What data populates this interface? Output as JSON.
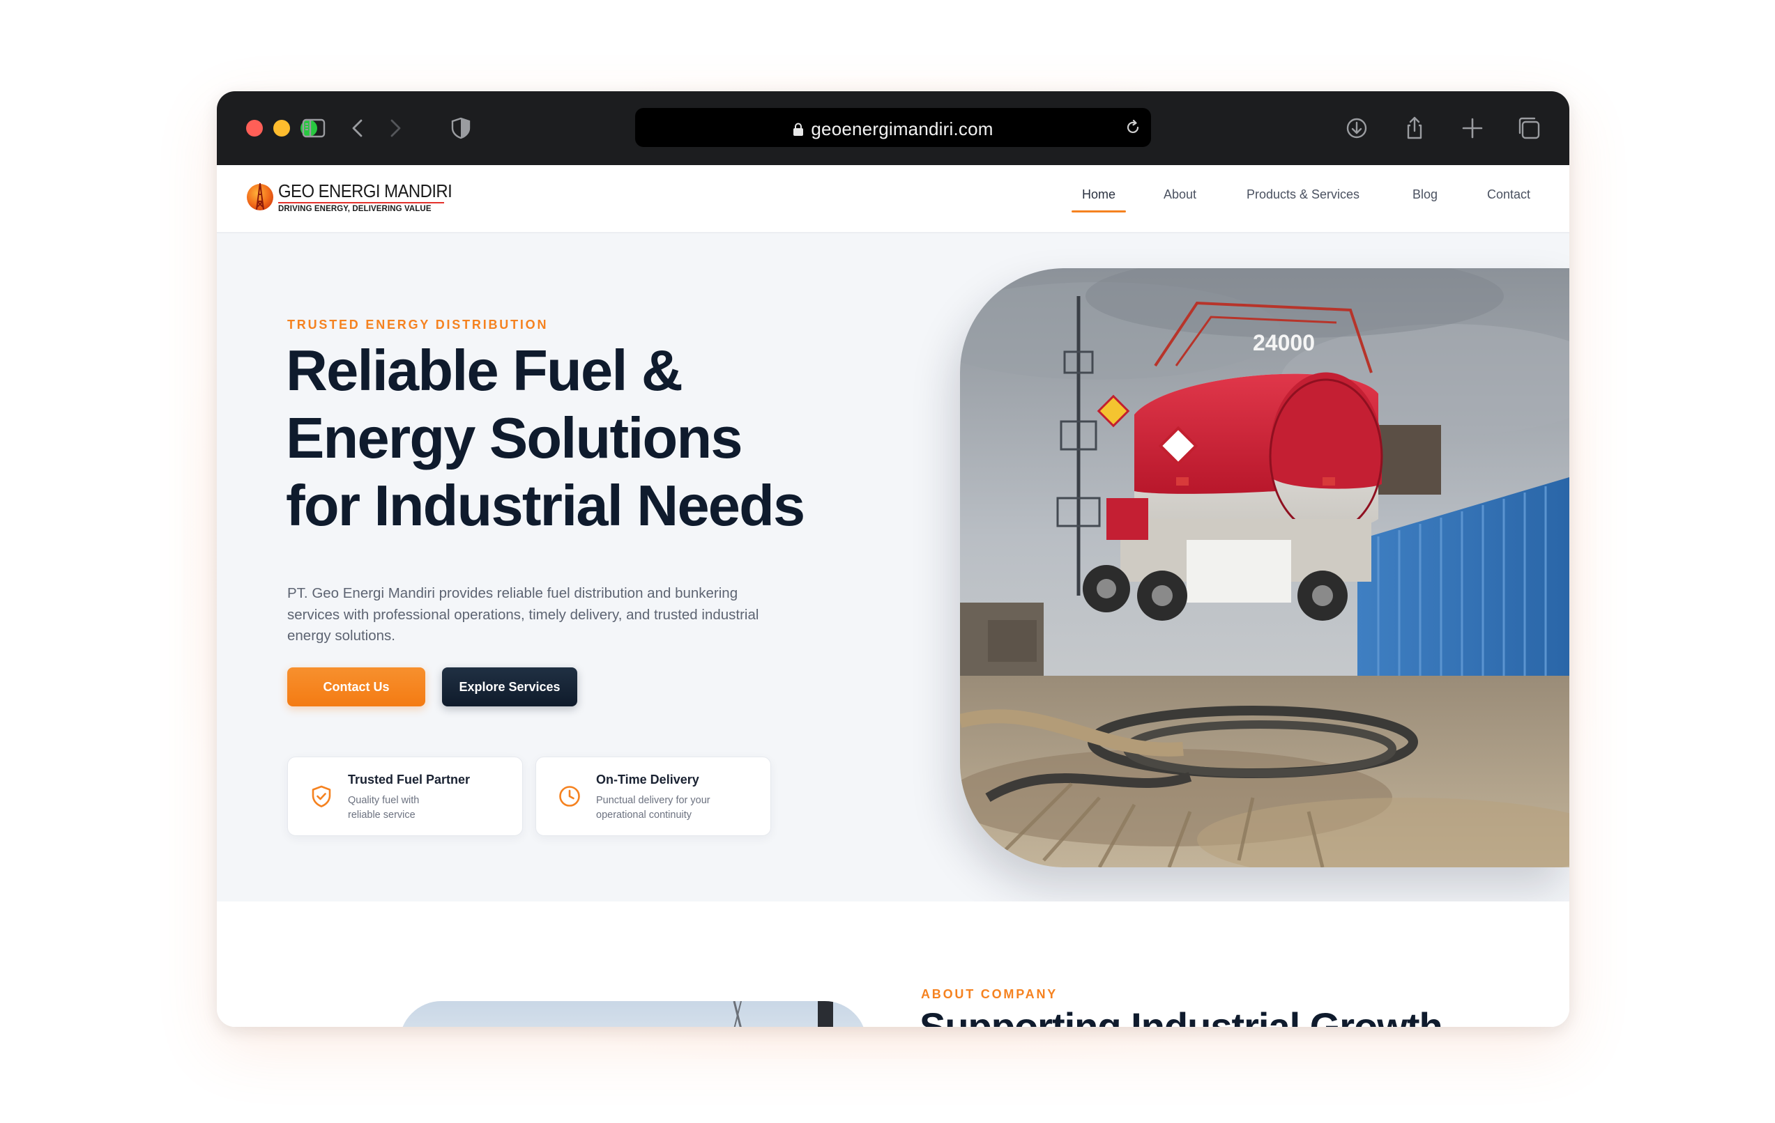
{
  "browser": {
    "url": "geoenergimandiri.com",
    "icons": [
      "sidebar-icon",
      "back-icon",
      "forward-icon",
      "shield-icon",
      "lock-icon",
      "reload-icon",
      "download-icon",
      "share-icon",
      "new-tab-icon",
      "tabs-overview-icon"
    ]
  },
  "header": {
    "logo": {
      "name": "GEO ENERGI MANDIRI",
      "tagline": "DRIVING ENERGY, DELIVERING VALUE"
    },
    "nav": {
      "home": "Home",
      "about": "About",
      "products": "Products & Services",
      "blog": "Blog",
      "contact": "Contact"
    },
    "active": "Home"
  },
  "hero": {
    "eyebrow": "TRUSTED ENERGY DISTRIBUTION",
    "title_line1": "Reliable Fuel &",
    "title_line2": "Energy Solutions",
    "title_line3": "for Industrial Needs",
    "description": "PT. Geo Energi Mandiri provides reliable fuel distribution and bunkering services with professional operations, timely delivery, and trusted industrial energy solutions.",
    "primary_button": "Contact Us",
    "secondary_button": "Explore Services",
    "features": [
      {
        "icon": "shield-check-icon",
        "title": "Trusted Fuel Partner",
        "description": "Quality fuel with reliable service"
      },
      {
        "icon": "clock-icon",
        "title": "On-Time Delivery",
        "description": "Punctual delivery for your operational continuity"
      }
    ],
    "photo_label": "24000"
  },
  "about": {
    "eyebrow": "ABOUT COMPANY",
    "title": "Supporting Industrial Growth"
  },
  "colors": {
    "accent": "#f58220",
    "dark": "#0f1b2d",
    "chrome": "#1c1d1f",
    "hero_bg": "#f4f6f9"
  }
}
